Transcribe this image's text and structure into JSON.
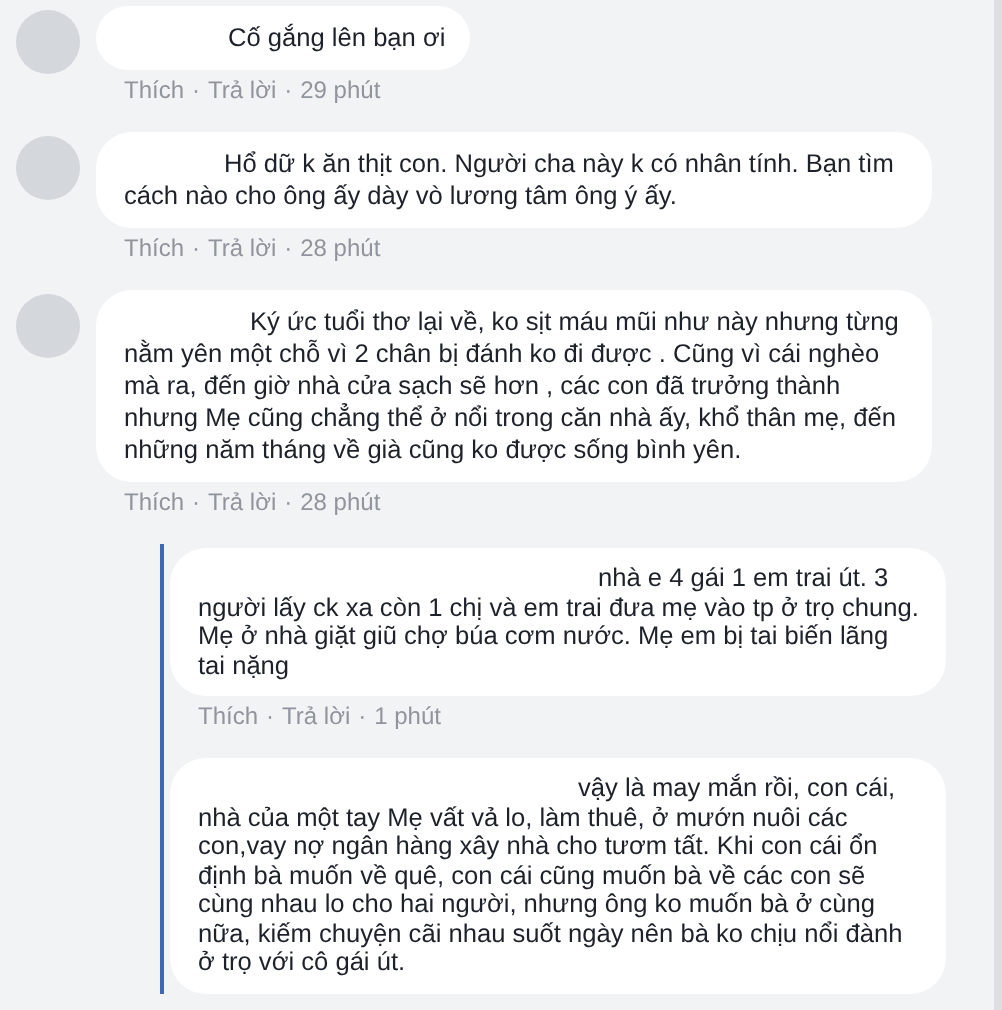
{
  "comments": [
    {
      "text": "Cố gắng lên bạn ơi",
      "actions": [
        "Thích",
        "Trả lời"
      ],
      "separator": "·",
      "time": "29 phút"
    },
    {
      "text": "Hổ dữ k ăn thịt con. Người cha này k có nhân tính. Bạn tìm cách nào cho ông ấy dày vò lương tâm ông ý ấy.",
      "actions": [
        "Thích",
        "Trả lời"
      ],
      "separator": "·",
      "time": "28 phút"
    },
    {
      "text": "Ký ức tuổi thơ lại về, ko sịt máu mũi như này nhưng từng nằm yên một chỗ vì 2 chân bị đánh ko đi được . Cũng vì cái nghèo mà ra, đến giờ nhà cửa sạch sẽ hơn , các con đã trưởng thành nhưng Mẹ cũng chẳng thể ở nổi trong căn nhà ấy, khổ thân mẹ, đến những năm tháng về già cũng ko được sống bình yên.",
      "actions": [
        "Thích",
        "Trả lời"
      ],
      "separator": "·",
      "time": "28 phút",
      "children": [
        {
          "text": "nhà e 4 gái 1 em trai út. 3 người lấy ck xa còn 1 chị và em trai đưa mẹ vào tp ở trọ chung. Mẹ ở nhà giặt giũ chợ búa cơm nước. Mẹ em bị tai biến lãng tai nặng",
          "actions": [
            "Thích",
            "Trả lời"
          ],
          "separator": "·",
          "time": "1 phút"
        },
        {
          "text": "vậy là may mắn rồi, con cái, nhà của một tay Mẹ vất vả lo, làm thuê, ở mướn nuôi các con,vay nợ ngân hàng xây nhà cho tươm tất. Khi con cái ổn định bà muốn về quê, con cái cũng muốn bà về các con sẽ cùng nhau lo cho hai người, nhưng ông ko muốn bà ở cùng nữa, kiếm chuyện cãi nhau suốt ngày nên bà ko chịu nổi đành ở trọ với cô gái út."
        }
      ]
    }
  ]
}
